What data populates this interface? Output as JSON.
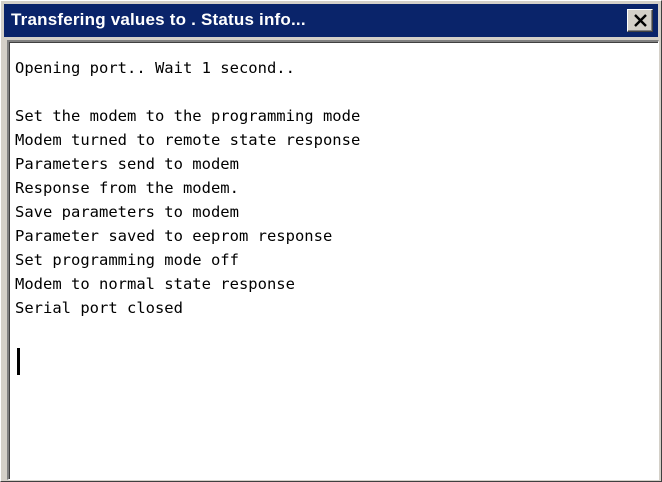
{
  "window": {
    "title": "Transfering values to . Status info..."
  },
  "log": {
    "lines": [
      "Opening port.. Wait 1 second..",
      "",
      "Set the modem to the programming mode",
      "Modem turned to remote state response",
      "Parameters send to modem",
      "Response from the modem.",
      "Save parameters to modem",
      "Parameter saved to eeprom response",
      "Set programming mode off",
      "Modem to normal state response",
      "Serial port closed"
    ]
  },
  "icons": {
    "close": "close-icon"
  }
}
